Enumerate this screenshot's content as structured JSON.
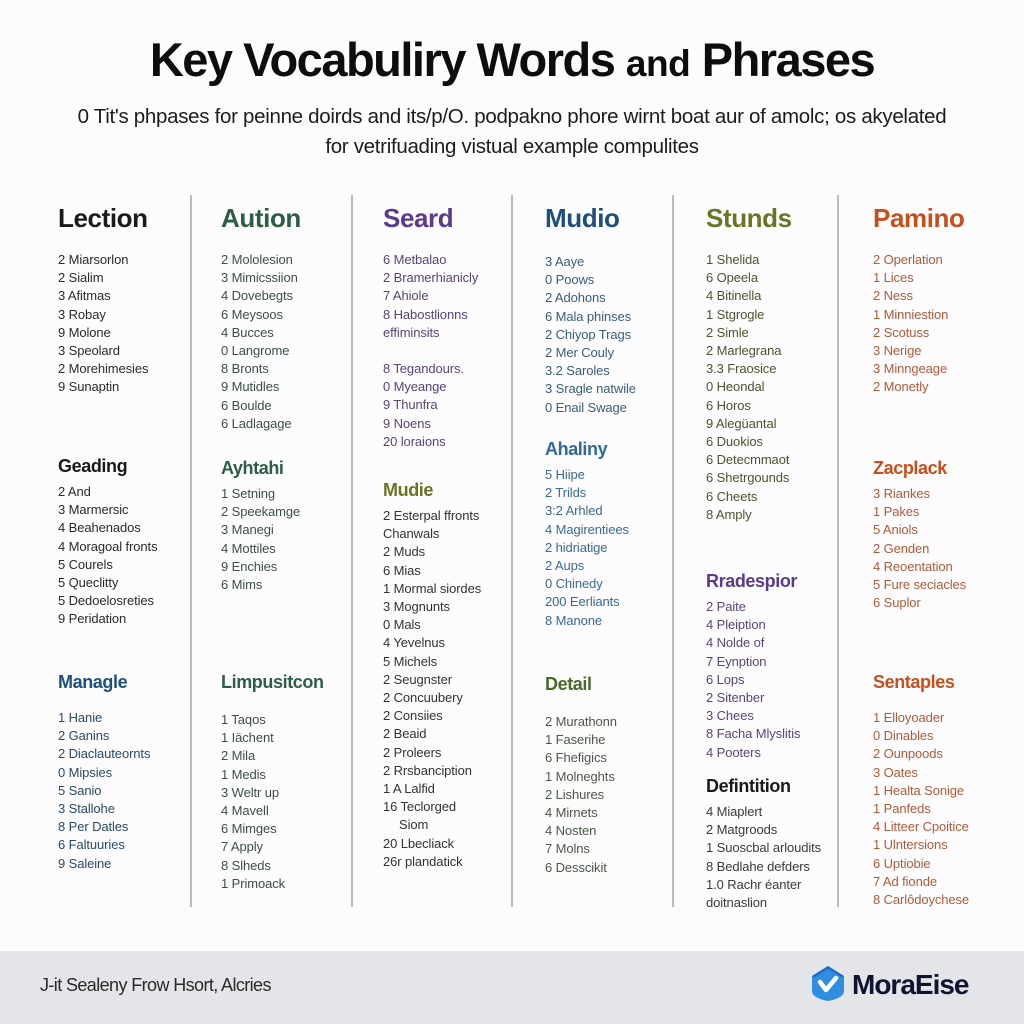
{
  "header": {
    "title_part1": "Key Vocabuliry Words",
    "title_part2": "and",
    "title_part3": "Phrases",
    "subtitle_line1": "0 Tit's phpases for peinne doirds and its/p/O. podpakno phore wirnt boat aur of amolc; os akyelated",
    "subtitle_line2": "for vetrifuading vistual example compulites"
  },
  "colors": {
    "black": "#1a1a1a",
    "dark_green": "#2e5e42",
    "purple": "#5b3a8a",
    "navy_blue": "#1d4f7c",
    "olive": "#6b7424",
    "orange": "#c5501e",
    "olive_green": "#4a6a2e",
    "steel_blue": "#2d6a9a",
    "footer_bg": "#e3e5e8",
    "logo_blue": "#2f8ee0",
    "logo_text": "#0f1430"
  },
  "columns": [
    {
      "sections": [
        {
          "heading": "Lection",
          "color": "#1a1a1a",
          "items": [
            "2 Miarsorlon",
            "2 Sialim",
            "3 Afitmas",
            "3 Robay",
            "9 Molone",
            "3 Speolard",
            "2 Morehimesies",
            "9 Sunaptin"
          ]
        },
        {
          "heading": "Geading",
          "color": "#1a1a1a",
          "items": [
            "2 And",
            "3 Marmersic",
            "4 Beahenados",
            "4 Moragoal fronts",
            "5 Courels",
            "5 Queclitty",
            "5 Dedoelosreties",
            "9 Peridation"
          ]
        },
        {
          "heading": "Managle",
          "color": "#1d4f7c",
          "items": [
            "1 Hanie",
            "2 Ganins",
            "2 Diaclauteornts",
            "0 Mipsies",
            "5 Sanio",
            "3 Stallohe",
            "8 Per Datles",
            "6 Faltuuries",
            "9 Saleine"
          ]
        }
      ]
    },
    {
      "sections": [
        {
          "heading": "Aution",
          "color": "#2e5e42",
          "items": [
            "2 Mololesion",
            "3 Mimicssiion",
            "4 Dovebegts",
            "6 Meysoos",
            "4 Bucces",
            "0 Langrome",
            "8 Bronts",
            "9 Mutidles",
            "6 Boulde",
            "6 Ladlagage"
          ]
        },
        {
          "heading": "Ayhtahi",
          "color": "#2e5e42",
          "items": [
            "1 Setning",
            "2 Speekamge",
            "3 Manegi",
            "4 Mottiles",
            "9 Enchies",
            "6 Mims"
          ]
        },
        {
          "heading": "Limpusitcon",
          "color": "#2e5e42",
          "items": [
            "1 Taqos",
            "1 Iächent",
            "2 Mila",
            "1 Medis",
            "3 Weltr up",
            "4 Mavell",
            "6 Mimges",
            "7 Apply",
            "8 Slheds",
            "1 Primoack"
          ]
        }
      ]
    },
    {
      "sections": [
        {
          "heading": "Seard",
          "color": "#5b3a8a",
          "items": [
            "6 Metbalao",
            "2 Bramerhianicly",
            "7 Ahiole",
            "8 Habostlionns",
            "effiminsits",
            "8 Tegandours.",
            "0 Myeange",
            "9 Thunfra",
            "9 Noens",
            "20 loraions"
          ]
        },
        {
          "heading": "Mudie",
          "color": "#6b7424",
          "items": [
            "2 Esterpal ffronts",
            "Chanwals",
            "2 Muds",
            "6 Mias",
            "1 Mormal siordes",
            "3 Mognunts",
            "0 Mals",
            "4 Yevelnus",
            "5 Michels",
            "2 Seugnster",
            "2 Concuubery",
            "2 Consiies",
            "2 Beaid",
            "2 Proleers",
            "2 Rrsbanciption",
            "1 A Lalfid",
            "16 Teclorged",
            "Siom",
            "20 Lbecliack",
            "26r plandatick"
          ]
        }
      ]
    },
    {
      "sections": [
        {
          "heading": "Mudio",
          "color": "#1d4f7c",
          "items": [
            "3 Aaye",
            "0 Poows",
            "2 Adohons",
            "6 Mala phinses",
            "2 Chiyop Trags",
            "2 Mer Couly",
            "3.2 Saroles",
            "3 Sragle natwile",
            "0 Enail Swage"
          ]
        },
        {
          "heading": "Ahaliny",
          "color": "#2d6a9a",
          "items": [
            "5 Hiipe",
            "2 Trilds",
            "3:2 Arhled",
            "4 Magirentiees",
            "2 hidriatige",
            "2 Aups",
            "0 Chinedy",
            "200 Eerliants",
            "8 Manone"
          ]
        },
        {
          "heading": "Detail",
          "color": "#4a6a2e",
          "items": [
            "2 Murathonn",
            "1 Faserihe",
            "6 Fhefigics",
            "1 Molneghts",
            "2 Lishures",
            "4 Mirnets",
            "4 Nosten",
            "7 Molns",
            "6 Desscikit"
          ]
        }
      ]
    },
    {
      "sections": [
        {
          "heading": "Stunds",
          "color": "#6b7424",
          "items": [
            "1 Shelida",
            "6 Opeela",
            "4 Bitinella",
            "1 Stgrogle",
            "2 Simle",
            "2 Marlegrana",
            "3.3 Fraosice",
            "0 Heondal",
            "6 Horos",
            "9 Alegüantal",
            "6 Duokios",
            "6 Detecmmaot",
            "6 Shetrgounds",
            "6 Cheets",
            "8 Amply"
          ]
        },
        {
          "heading": "Rradespior",
          "color": "#5b3a8a",
          "items": [
            "2 Paite",
            "4 Pleiption",
            "4 Nolde of",
            "7 Eynption",
            "6 Lops",
            "2 Sitenber",
            "3 Chees",
            "8 Facha Mlyslitis",
            "4 Pooters"
          ]
        },
        {
          "heading": "Defintition",
          "color": "#1a1a1a",
          "items": [
            "4 Miaplert",
            "2 Matgroods",
            "1 Suoscbal arloudits",
            "8 Bedlahe defders",
            "1.0 Rachr éanter",
            "doitnaslion"
          ]
        }
      ]
    },
    {
      "sections": [
        {
          "heading": "Pamino",
          "color": "#c5501e",
          "items": [
            "2 Operlation",
            "1 Lices",
            "2 Ness",
            "1 Minniestion",
            "2 Scotuss",
            "3 Nerige",
            "3 Minngeage",
            "2 Monetly"
          ]
        },
        {
          "heading": "Zacplack",
          "color": "#c5501e",
          "items": [
            "3 Riankes",
            "1 Pakes",
            "5 Aniols",
            "2 Genden",
            "4 Reoentation",
            "5 Fure seciacles",
            "6 Suplor"
          ]
        },
        {
          "heading": "Sentaples",
          "color": "#c5501e",
          "items": [
            "1 Elloyoader",
            "0 Dinables",
            "2 Ounpoods",
            "3 Oates",
            "1 Healta Sonige",
            "1 Panfeds",
            "4 Litteer Cpoitice",
            "1 Ulntersions",
            "6 Uptiobie",
            "7 Ad fionde",
            "8 Carlôdoychese"
          ]
        }
      ]
    }
  ],
  "footer": {
    "text": "J-it Sealeny Frow Hsort, Alcries",
    "logo_icon": "shield-check-icon",
    "logo_text": "MoraEise"
  }
}
